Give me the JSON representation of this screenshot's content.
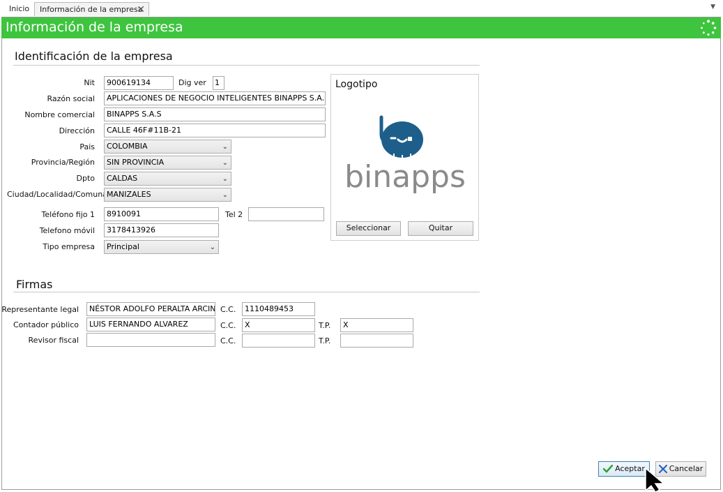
{
  "tabs": {
    "home": "Inicio",
    "active": "Información de la empresa",
    "close": "✕",
    "menu": "▼"
  },
  "window": {
    "title": "Información de la empresa"
  },
  "colors": {
    "title_bar": "#3ec43e",
    "accept_check": "#2aa52a",
    "cancel_x": "#1f5fbf"
  },
  "identificacion": {
    "title": "Identificación de la empresa",
    "nit_label": "Nit",
    "nit": "900619134",
    "digver_label": "Dig ver",
    "digver": "1",
    "razon_label": "Razón social",
    "razon": "APLICACIONES DE NEGOCIO INTELIGENTES BINAPPS S.A.S",
    "nombre_label": "Nombre comercial",
    "nombre": "BINAPPS S.A.S",
    "direccion_label": "Dirección",
    "direccion": "CALLE 46F#11B-21",
    "pais_label": "Pais",
    "pais": "COLOMBIA",
    "provincia_label": "Provincia/Región",
    "provincia": "SIN PROVINCIA",
    "dpto_label": "Dpto",
    "dpto": "CALDAS",
    "ciudad_label": "Ciudad/Localidad/Comuna",
    "ciudad": "MANIZALES",
    "tel1_label": "Teléfono fijo 1",
    "tel1": "8910091",
    "tel2_label": "Tel 2",
    "tel2": "",
    "movil_label": "Telefono móvil",
    "movil": "3178413926",
    "tipo_label": "Tipo empresa",
    "tipo": "Principal"
  },
  "logo": {
    "title": "Logotipo",
    "brand_text": "binapps",
    "select_label": "Seleccionar",
    "remove_label": "Quitar"
  },
  "firmas": {
    "title": "Firmas",
    "rep_label": "Representante legal",
    "rep_name": "NÉSTOR ADOLFO PERALTA ARCINIEGAS",
    "rep_cc": "1110489453",
    "contador_label": "Contador público",
    "contador_name": "LUIS FERNANDO ALVAREZ",
    "contador_cc": "X",
    "contador_tp": "X",
    "revisor_label": "Revisor fiscal",
    "revisor_name": "",
    "revisor_cc": "",
    "revisor_tp": "",
    "cc_label": "C.C.",
    "tp_label": "T.P."
  },
  "footer": {
    "accept": "Aceptar",
    "cancel": "Cancelar"
  }
}
